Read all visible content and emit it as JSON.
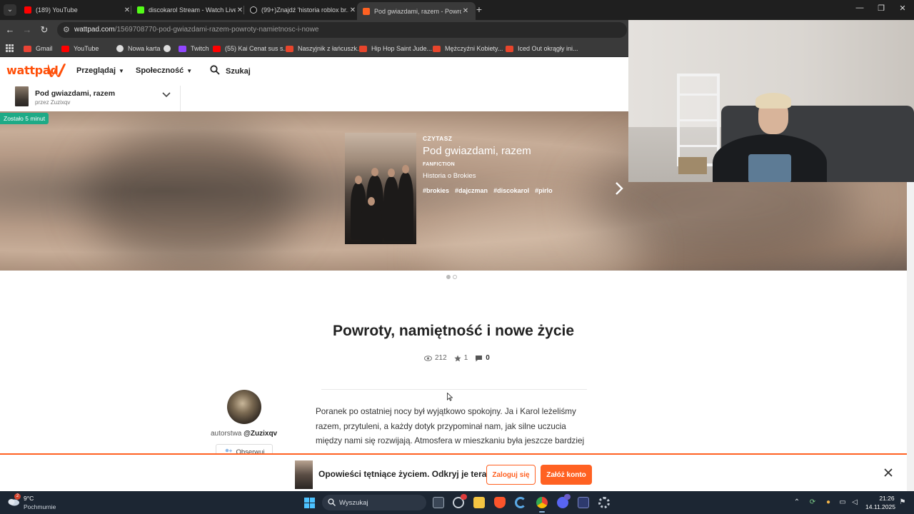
{
  "browser": {
    "tabs": [
      {
        "title": "(189) YouTube",
        "color": "#ff0000",
        "active": false
      },
      {
        "title": "discokarol Stream - Watch Live",
        "color": "#53fc18",
        "active": false
      },
      {
        "title": "(99+)Znajdź 'historia roblox br...",
        "color": "#ffffff",
        "active": false
      },
      {
        "title": "Pod gwiazdami, razem - Powrot...",
        "color": "#ff6122",
        "active": true
      }
    ],
    "url_host": "wattpad.com",
    "url_path": "/1569708770-pod-gwiazdami-razem-powroty-namietnosc-i-nowe",
    "bookmarks": [
      {
        "label": "Gmail",
        "color": "#ea4335"
      },
      {
        "label": "YouTube",
        "color": "#ff0000"
      },
      {
        "label": "Nowa karta",
        "color": "#cccccc"
      },
      {
        "label": "",
        "color": "#cccccc"
      },
      {
        "label": "Twitch",
        "color": "#9146ff"
      },
      {
        "label": "(55) Kai Cenat sus s...",
        "color": "#ff0000"
      },
      {
        "label": "Naszyjnik z łańcuszk...",
        "color": "#e8452c"
      },
      {
        "label": "Hip Hop Saint Jude...",
        "color": "#e8452c"
      },
      {
        "label": "Mężczyźni Kobiety...",
        "color": "#e8452c"
      },
      {
        "label": "Iced Out okrągły ini...",
        "color": "#e8452c"
      }
    ]
  },
  "header": {
    "logo_text": "wattpad",
    "browse_label": "Przeglądaj",
    "community_label": "Społeczność",
    "search_label": "Szukaj"
  },
  "story_bar": {
    "title": "Pod gwiazdami, razem",
    "byline": "przez Zuzixqv"
  },
  "hero": {
    "badge": "Zostało 5 minut",
    "kicker": "CZYTASZ",
    "title": "Pod gwiazdami, razem",
    "category": "FANFICTION",
    "description": "Historia o Brokies",
    "tags": [
      "#brokies",
      "#dajczman",
      "#discokarol",
      "#pirlo"
    ],
    "slides_total": 2,
    "slide_active": 1
  },
  "chapter": {
    "title": "Powroty, namiętność i nowe życie",
    "views": "212",
    "votes": "1",
    "comments": "0"
  },
  "author": {
    "prefix": "autorstwa",
    "handle": "@Zuzixqv",
    "follow_label": "Obserwuj"
  },
  "body_text": "Poranek po ostatniej nocy był wyjątkowo spokojny. Ja i Karol leżeliśmy razem, przytuleni, a każdy dotyk przypominał nam, jak silne uczucia między nami się rozwijają. Atmosfera w mieszkaniu była jeszcze bardziej",
  "cta": {
    "text": "Opowieści tętniące życiem. Odkryj je teraz",
    "login_label": "Zaloguj się",
    "signup_label": "Załóż konto"
  },
  "taskbar": {
    "temperature": "9°C",
    "weather": "Pochmurnie",
    "weather_badge": "2",
    "search_label": "Wyszukaj",
    "time": "21:26",
    "date": "14.11.2025"
  },
  "colors": {
    "brand": "#ff6122",
    "badge_green": "#1eaa86"
  }
}
